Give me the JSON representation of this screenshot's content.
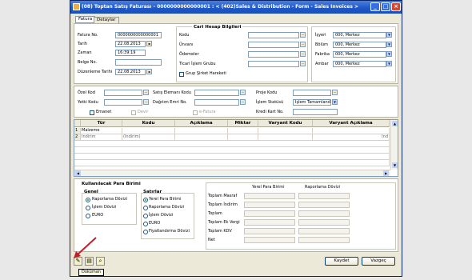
{
  "window": {
    "title": "(08) Toptan Satış Faturası - 0000000000000001 : < (402)Sales & Distribution - Form - Sales Invoices >"
  },
  "tabs": [
    "Fatura",
    "Detaylar"
  ],
  "doc": {
    "fatura_no_label": "Fatura No.",
    "fatura_no": "0000000000000001",
    "tarih_label": "Tarih",
    "tarih": "22.08.2013",
    "zaman_label": "Zaman",
    "zaman": "16:39:19",
    "belge_no_label": "Belge No.",
    "duzenleme_label": "Düzenleme Tarihi",
    "duzenleme": "22.08.2013"
  },
  "cari": {
    "title": "Cari Hesap Bilgileri",
    "kodu": "Kodu",
    "unvani": "Ünvanı",
    "odemeler": "Ödemeler",
    "ticari": "Ticari İşlem Grubu",
    "grup": "Grup Şirket Hareketi"
  },
  "org": {
    "isyeri_label": "İşyeri",
    "isyeri": "000, Merkez",
    "bolum_label": "Bölüm",
    "bolum": "000, Merkez",
    "fabrika_label": "Fabrika",
    "fabrika": "000, Merkez",
    "ambar_label": "Ambar",
    "ambar": "000, Merkez"
  },
  "mid": {
    "ozel_kod": "Özel Kod",
    "yetki_kodu": "Yetki Kodu",
    "satis_eleman": "Satış Elemanı Kodu",
    "dagitim": "Dağıtım Emri No.",
    "proje_kodu": "Proje Kodu",
    "islem_statusu": "İşlem Statüsü",
    "islem_value": "İşlem Tamamlandı",
    "kredi_kart": "Kredi Kart No.",
    "emanet": "Emanet",
    "devir": "Devir",
    "efatura": "e-Fatura"
  },
  "grid": {
    "headers": [
      "Tür",
      "Kodu",
      "Açıklama",
      "Miktar",
      "Varyant Kodu",
      "Varyant Açıklama"
    ],
    "rows": [
      {
        "num": "1",
        "tur": "Malzeme",
        "kodu": "",
        "extra": ""
      },
      {
        "num": "2",
        "tur": "İndirim",
        "kodu": "(İndirim)",
        "extra": "İnd"
      }
    ]
  },
  "currency": {
    "title": "Kullanılacak Para Birimi",
    "genel_title": "Genel",
    "genel": [
      "Raporlama Dövizi",
      "İşlem Dövizi",
      "EURO"
    ],
    "satirlar_title": "Satırlar",
    "satirlar": [
      "Yerel Para Birimi",
      "Raporlama Dövizi",
      "İşlem Dövizi",
      "EURO",
      "Fiyatlandırma Dövizi"
    ]
  },
  "totals": {
    "col1": "Yerel Para Birimi",
    "col2": "Raporlama Dövizi",
    "rows": [
      "Toplam Masraf",
      "Toplam İndirim",
      "Toplam",
      "Toplam Ek Vergi",
      "Toplam KDV",
      "Net"
    ]
  },
  "buttons": {
    "kaydet": "Kaydet",
    "vazgec": "Vazgeç"
  },
  "tooltip": "Doküman",
  "colors": {
    "titlebar": "#1c56c8",
    "window_bg": "#ece9d8",
    "arrow": "#c0202a"
  }
}
